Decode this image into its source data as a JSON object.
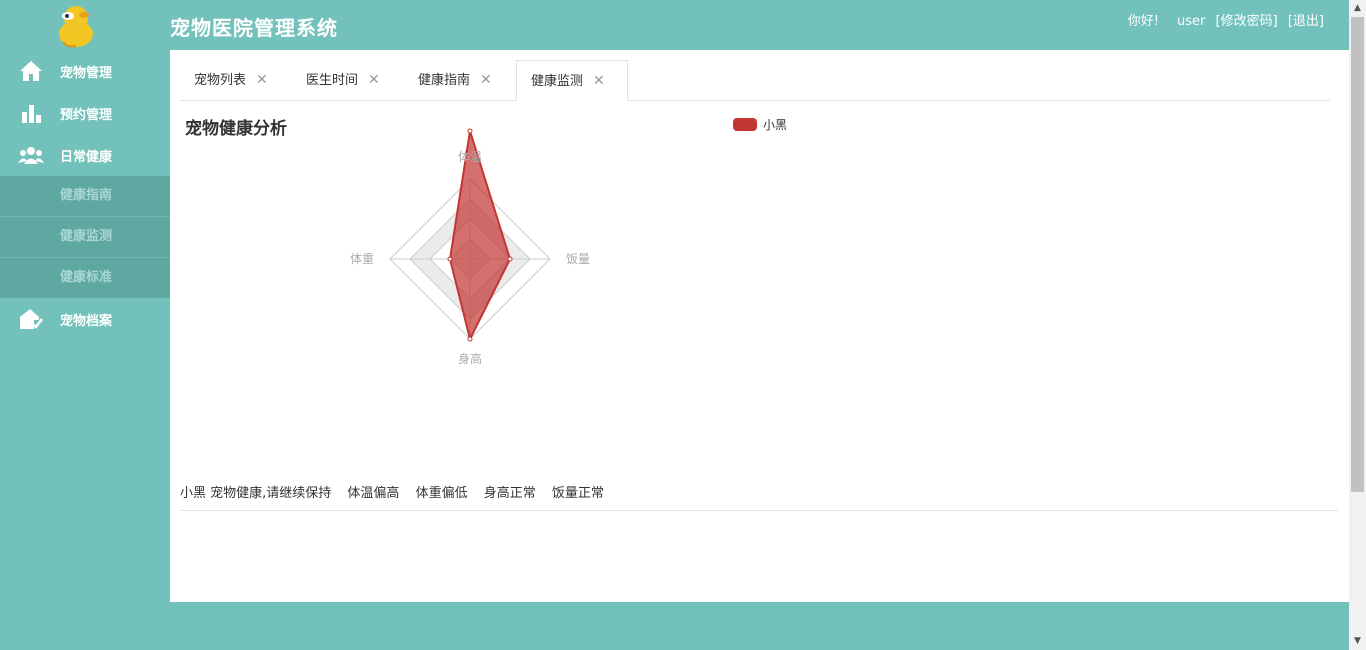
{
  "header": {
    "title": "宠物医院管理系统",
    "greeting": "你好!",
    "username": "user",
    "change_password": "[修改密码]",
    "logout": "[退出]"
  },
  "sidebar": {
    "items": [
      {
        "label": "宠物管理",
        "icon": "home-icon"
      },
      {
        "label": "预约管理",
        "icon": "bar-chart-icon"
      },
      {
        "label": "日常健康",
        "icon": "users-icon"
      }
    ],
    "subitems": [
      "健康指南",
      "健康监测",
      "健康标准"
    ],
    "last_item": {
      "label": "宠物档案",
      "icon": "house-check-icon"
    }
  },
  "tabs": [
    {
      "label": "宠物列表",
      "active": false
    },
    {
      "label": "医生时间",
      "active": false
    },
    {
      "label": "健康指南",
      "active": false
    },
    {
      "label": "健康监测",
      "active": true
    }
  ],
  "chart_data": {
    "type": "radar",
    "title": "宠物健康分析",
    "indicators": [
      "体温",
      "饭量",
      "身高",
      "体重"
    ],
    "series": [
      {
        "name": "小黑",
        "values": [
          1.6,
          0.5,
          1.0,
          0.25
        ]
      }
    ],
    "max": 1.0,
    "color": "#c23531",
    "legend_position": "top-center"
  },
  "status": {
    "pet_summary": "小黑 宠物健康,请继续保持",
    "items": [
      "体温偏高",
      "体重偏低",
      "身高正常",
      "饭量正常"
    ]
  },
  "colors": {
    "brand": "#72c2bb",
    "submenu": "#5fa7a1",
    "series": "#c23531"
  }
}
